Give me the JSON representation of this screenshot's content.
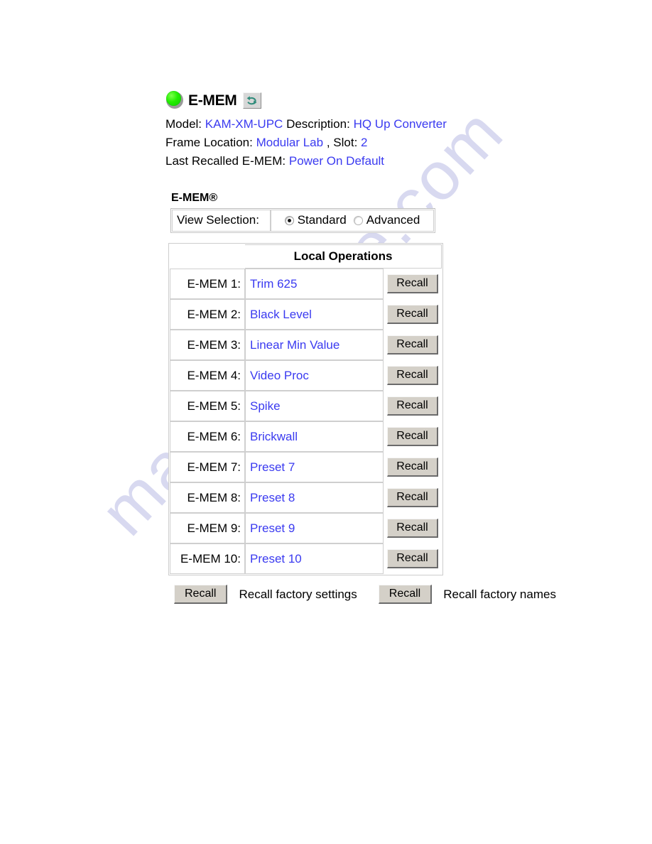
{
  "header": {
    "status_led": "green",
    "status_color": "#22ee00",
    "app_title": "E-MEM",
    "refresh_icon": "refresh-icon",
    "link_color": "#3a3af0"
  },
  "device_info": {
    "model_label": "Model:",
    "model_value": "KAM-XM-UPC",
    "description_label": "Description:",
    "description_value": "HQ Up Converter",
    "frame_location_label": "Frame Location:",
    "frame_location_value": "Modular Lab",
    "slot_label": ", Slot:",
    "slot_value": "2",
    "last_recalled_label": "Last Recalled E-MEM:",
    "last_recalled_value": "Power On Default"
  },
  "section": {
    "heading": "E-MEM®"
  },
  "view_selection": {
    "label": "View Selection:",
    "options": [
      {
        "label": "Standard",
        "selected": true
      },
      {
        "label": "Advanced",
        "selected": false
      }
    ]
  },
  "table": {
    "header_blank": "",
    "header_operations": "Local Operations",
    "recall_label": "Recall",
    "rows": [
      {
        "slot": "E-MEM 1:",
        "name": "Trim 625",
        "button": "Recall"
      },
      {
        "slot": "E-MEM 2:",
        "name": "Black Level",
        "button": "Recall"
      },
      {
        "slot": "E-MEM 3:",
        "name": "Linear Min Value",
        "button": "Recall"
      },
      {
        "slot": "E-MEM 4:",
        "name": "Video Proc",
        "button": "Recall"
      },
      {
        "slot": "E-MEM 5:",
        "name": "Spike",
        "button": "Recall"
      },
      {
        "slot": "E-MEM 6:",
        "name": "Brickwall",
        "button": "Recall"
      },
      {
        "slot": "E-MEM 7:",
        "name": "Preset 7",
        "button": "Recall"
      },
      {
        "slot": "E-MEM 8:",
        "name": "Preset 8",
        "button": "Recall"
      },
      {
        "slot": "E-MEM 9:",
        "name": "Preset 9",
        "button": "Recall"
      },
      {
        "slot": "E-MEM 10:",
        "name": "Preset 10",
        "button": "Recall"
      }
    ]
  },
  "footer": {
    "settings_button": "Recall",
    "settings_text": "Recall factory settings",
    "names_button": "Recall",
    "names_text": "Recall factory names"
  },
  "watermark": {
    "text": "manualshive.com"
  }
}
